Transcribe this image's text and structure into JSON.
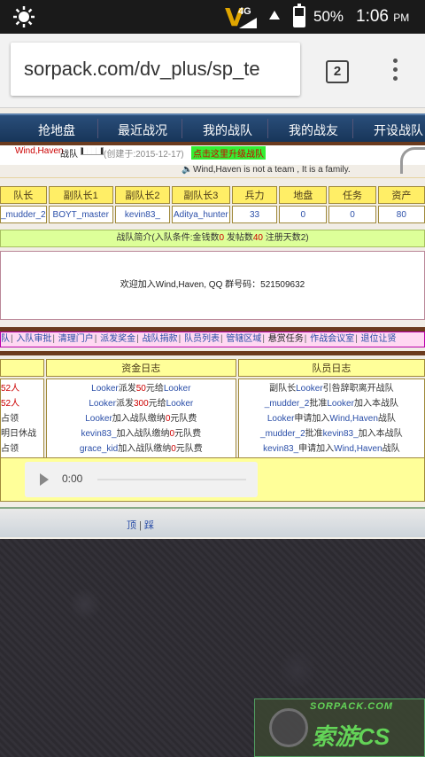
{
  "status": {
    "battery": "50%",
    "time": "1:06",
    "ampm": "PM",
    "net": "4G"
  },
  "browser": {
    "url": "sorpack.com/dv_plus/sp_te",
    "tabs": "2"
  },
  "nav": [
    "抢地盘",
    "最近战况",
    "我的战队",
    "我的战友",
    "开设战队"
  ],
  "team": {
    "name": "Wind,Haven",
    "suffix": "战队",
    "badge": "████",
    "created": "(创建于:2015-12-17)",
    "upgrade": "点击这里升级战队",
    "motto": "Wind,Haven is not a team , It is a family."
  },
  "roster": {
    "headers": [
      "队长",
      "副队长1",
      "副队长2",
      "副队长3",
      "兵力",
      "地盘",
      "任务",
      "资产"
    ],
    "values": [
      "_mudder_2",
      "BOYT_master",
      "kevin83_",
      "Aditya_hunter",
      "33",
      "0",
      "0",
      "80"
    ]
  },
  "intro": {
    "label": "战队简介(入队条件:金钱数",
    "a": "0",
    "mid": " 发帖数",
    "b": "40",
    "end": " 注册天数2)",
    "text": "欢迎加入Wind,Haven, QQ 群号码：521509632"
  },
  "links": [
    "队",
    "入队审批",
    "清理门户",
    "派发奖金",
    "战队捐款",
    "队员列表",
    "管辖区域",
    "悬赏任务",
    "作战会议室",
    "退位让贤"
  ],
  "logs": {
    "headers": [
      "",
      "资金日志",
      "队员日志"
    ],
    "left": [
      "52人",
      "52人",
      "占领",
      "明日休战",
      "占领"
    ],
    "fund": [
      [
        "Looker",
        "派发",
        "50",
        "元给",
        "Looker"
      ],
      [
        "Looker",
        "派发",
        "300",
        "元给",
        "Looker"
      ],
      [
        "Looker",
        "加入战队缴纳",
        "0",
        "元队费",
        ""
      ],
      [
        "kevin83_",
        "加入战队缴纳",
        "0",
        "元队费",
        ""
      ],
      [
        "grace_kid",
        "加入战队缴纳",
        "0",
        "元队费",
        ""
      ]
    ],
    "member": [
      [
        "副队长",
        "Looker",
        "引咎辞职离开战队",
        "",
        ""
      ],
      [
        "_mudder_2",
        "批准",
        "Looker",
        "加入本战队",
        ""
      ],
      [
        "Looker",
        "申请加入",
        "Wind,Haven",
        "战队",
        ""
      ],
      [
        "_mudder_2",
        "批准",
        "kevin83_",
        "加入本战队",
        ""
      ],
      [
        "kevin83_",
        "申请加入",
        "Wind,Haven",
        "战队",
        ""
      ]
    ]
  },
  "audio": {
    "time": "0:00"
  },
  "footer": {
    "top": "顶",
    "sep": " | ",
    "bottom": "踩"
  },
  "logo": {
    "top": "SORPACK.COM",
    "main": "索游CS"
  },
  "colors": {
    "nav": "#1f3f66",
    "header_yellow": "#ffee66",
    "intro_green": "#ddff99",
    "links_pink": "#ffd8f2",
    "accent_red": "#cc0000",
    "link_blue": "#2a4ea8"
  }
}
